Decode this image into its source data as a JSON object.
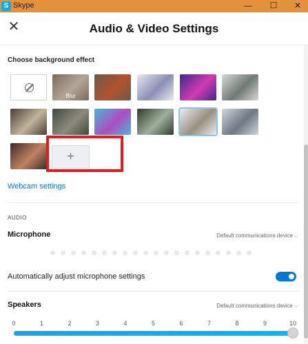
{
  "window": {
    "app_name": "Skype",
    "icon_letter": "S",
    "minimize_glyph": "—",
    "maximize_glyph": "☐",
    "close_glyph": "✕"
  },
  "header": {
    "title": "Audio & Video Settings",
    "close_glyph": "✕"
  },
  "background_effects": {
    "section_label": "Choose background effect",
    "blur_label": "Blur",
    "add_glyph": "+",
    "tiles": [
      {
        "name": "none",
        "colors": [
          "#ffffff",
          "#ffffff"
        ]
      },
      {
        "name": "blur",
        "colors": [
          "#7b6a5b",
          "#b3a79a"
        ]
      },
      {
        "name": "office-room",
        "colors": [
          "#6c5a4a",
          "#b2532e"
        ]
      },
      {
        "name": "snowy-room",
        "colors": [
          "#e8eaf0",
          "#8a8fb5"
        ]
      },
      {
        "name": "neon-hall",
        "colors": [
          "#3c2a8a",
          "#d23bb4"
        ]
      },
      {
        "name": "white-office",
        "colors": [
          "#d8d8d8",
          "#6f7a74"
        ]
      },
      {
        "name": "cafe-tables",
        "colors": [
          "#4a4033",
          "#c0b49c"
        ]
      },
      {
        "name": "lounge-green",
        "colors": [
          "#3f4a3e",
          "#8d8a7d"
        ]
      },
      {
        "name": "colorful-shapes",
        "colors": [
          "#49b7d8",
          "#b04cc0"
        ]
      },
      {
        "name": "green-lounge",
        "colors": [
          "#2f3b2d",
          "#9fb09c"
        ]
      },
      {
        "name": "bright-room",
        "colors": [
          "#e9ecef",
          "#9a8f7f"
        ]
      },
      {
        "name": "open-office",
        "colors": [
          "#cfd6dc",
          "#6e7883"
        ]
      },
      {
        "name": "sunset-street",
        "colors": [
          "#3d2a27",
          "#c08263"
        ]
      }
    ]
  },
  "webcam_link": "Webcam settings",
  "audio": {
    "section_label": "AUDIO",
    "microphone_label": "Microphone",
    "microphone_device": "Default communications device",
    "auto_adjust_label": "Automatically adjust microphone settings",
    "auto_adjust_on": true,
    "speakers_label": "Speakers",
    "speakers_device": "Default communications device",
    "chevron_glyph": "⌵",
    "volume_ticks": [
      "0",
      "1",
      "2",
      "3",
      "4",
      "5",
      "6",
      "7",
      "8",
      "9",
      "10"
    ],
    "volume_level": 10
  }
}
